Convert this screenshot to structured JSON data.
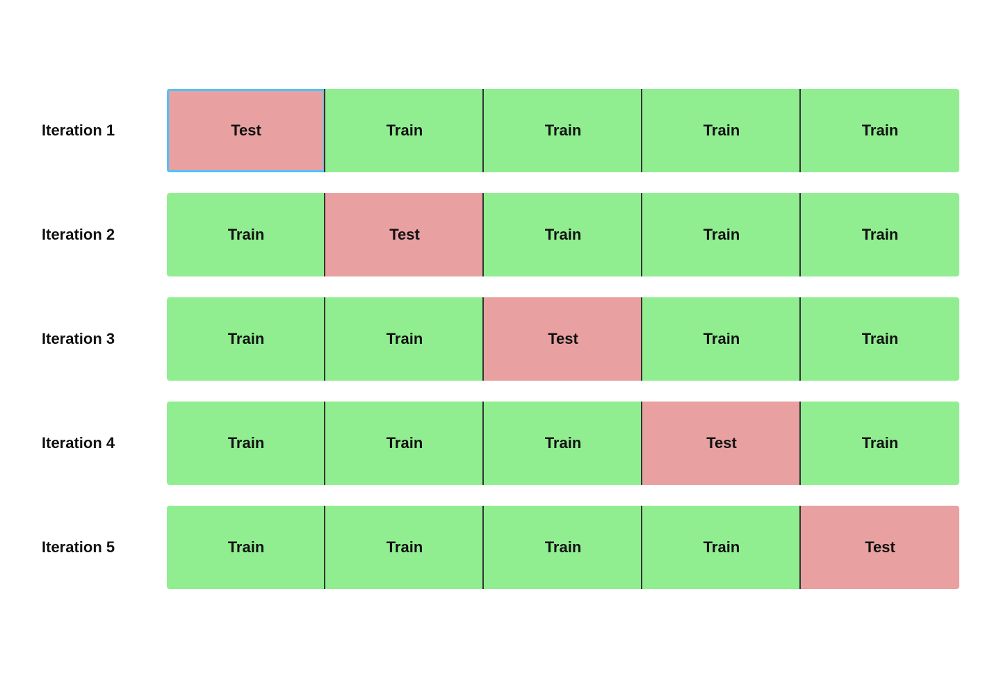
{
  "iterations": [
    {
      "label": "Iteration 1",
      "folds": [
        {
          "type": "test",
          "text": "Test",
          "highlighted": true
        },
        {
          "type": "train",
          "text": "Train",
          "highlighted": false
        },
        {
          "type": "train",
          "text": "Train",
          "highlighted": false
        },
        {
          "type": "train",
          "text": "Train",
          "highlighted": false
        },
        {
          "type": "train",
          "text": "Train",
          "highlighted": false
        }
      ]
    },
    {
      "label": "Iteration 2",
      "folds": [
        {
          "type": "train",
          "text": "Train",
          "highlighted": false
        },
        {
          "type": "test",
          "text": "Test",
          "highlighted": false
        },
        {
          "type": "train",
          "text": "Train",
          "highlighted": false
        },
        {
          "type": "train",
          "text": "Train",
          "highlighted": false
        },
        {
          "type": "train",
          "text": "Train",
          "highlighted": false
        }
      ]
    },
    {
      "label": "Iteration 3",
      "folds": [
        {
          "type": "train",
          "text": "Train",
          "highlighted": false
        },
        {
          "type": "train",
          "text": "Train",
          "highlighted": false
        },
        {
          "type": "test",
          "text": "Test",
          "highlighted": false
        },
        {
          "type": "train",
          "text": "Train",
          "highlighted": false
        },
        {
          "type": "train",
          "text": "Train",
          "highlighted": false
        }
      ]
    },
    {
      "label": "Iteration 4",
      "folds": [
        {
          "type": "train",
          "text": "Train",
          "highlighted": false
        },
        {
          "type": "train",
          "text": "Train",
          "highlighted": false
        },
        {
          "type": "train",
          "text": "Train",
          "highlighted": false
        },
        {
          "type": "test",
          "text": "Test",
          "highlighted": false
        },
        {
          "type": "train",
          "text": "Train",
          "highlighted": false
        }
      ]
    },
    {
      "label": "Iteration 5",
      "folds": [
        {
          "type": "train",
          "text": "Train",
          "highlighted": false
        },
        {
          "type": "train",
          "text": "Train",
          "highlighted": false
        },
        {
          "type": "train",
          "text": "Train",
          "highlighted": false
        },
        {
          "type": "train",
          "text": "Train",
          "highlighted": false
        },
        {
          "type": "test",
          "text": "Test",
          "highlighted": false
        }
      ]
    }
  ]
}
